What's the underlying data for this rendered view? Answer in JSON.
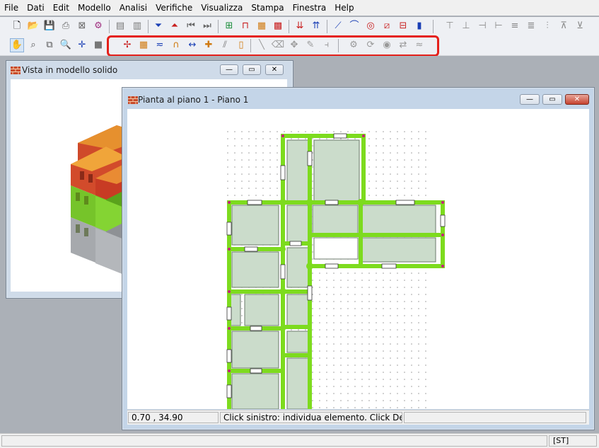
{
  "menu": [
    "File",
    "Dati",
    "Edit",
    "Modello",
    "Analisi",
    "Verifiche",
    "Visualizza",
    "Stampa",
    "Finestra",
    "Help"
  ],
  "windows": {
    "solid_view": {
      "title": "Vista in modello solido"
    },
    "plan_view": {
      "title": "Pianta al piano 1 - Piano 1"
    }
  },
  "controls": {
    "minimize": "—",
    "maximize": "▭",
    "close": "✕"
  },
  "status": {
    "coordinates": "0.70 , 34.90",
    "hint": "Click sinistro: individua elemento. Click Destro: s"
  },
  "app_status": {
    "mode": "[ST]"
  },
  "colors": {
    "wall_green": "#7ddb1e",
    "room_fill": "#cbdccb",
    "highlight": "#e5201a"
  }
}
